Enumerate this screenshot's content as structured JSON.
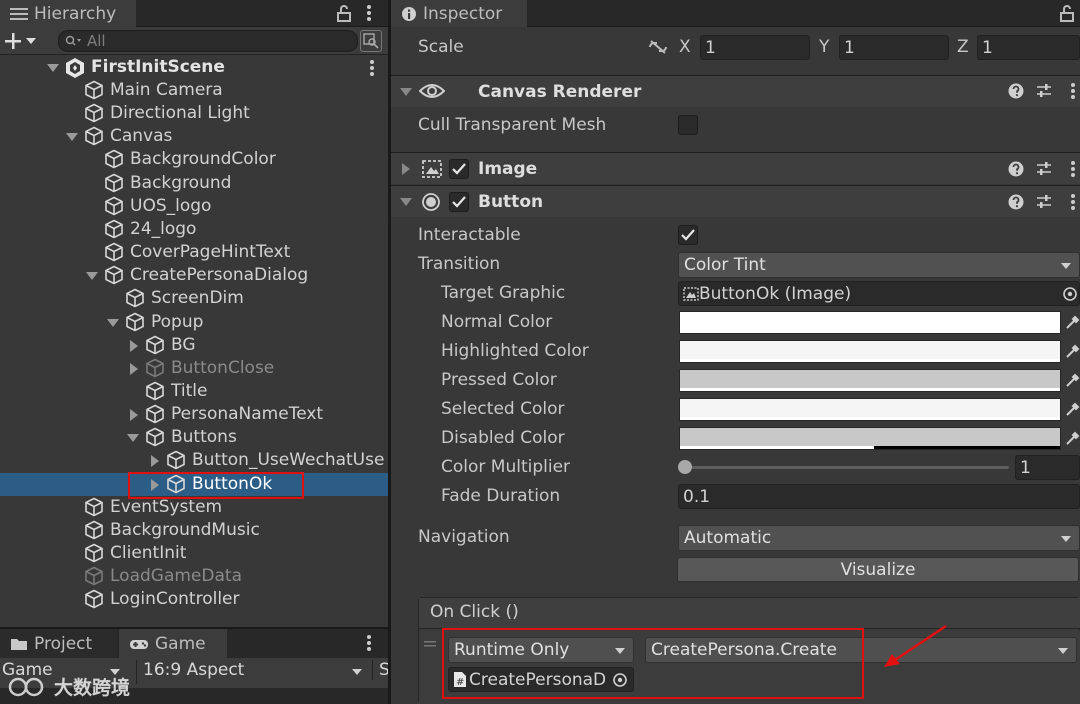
{
  "hierarchy": {
    "tab_label": "Hierarchy",
    "search_placeholder": "All",
    "scene_name": "FirstInitScene",
    "items": [
      {
        "label": "Main Camera"
      },
      {
        "label": "Directional Light"
      },
      {
        "label": "Canvas"
      },
      {
        "label": "BackgroundColor"
      },
      {
        "label": "Background"
      },
      {
        "label": "UOS_logo"
      },
      {
        "label": "24_logo"
      },
      {
        "label": "CoverPageHintText"
      },
      {
        "label": "CreatePersonaDialog"
      },
      {
        "label": "ScreenDim"
      },
      {
        "label": "Popup"
      },
      {
        "label": "BG"
      },
      {
        "label": "ButtonClose"
      },
      {
        "label": "Title"
      },
      {
        "label": "PersonaNameText"
      },
      {
        "label": "Buttons"
      },
      {
        "label": "Button_UseWechatUse"
      },
      {
        "label": "ButtonOk"
      },
      {
        "label": "EventSystem"
      },
      {
        "label": "BackgroundMusic"
      },
      {
        "label": "ClientInit"
      },
      {
        "label": "LoadGameData"
      },
      {
        "label": "LoginController"
      }
    ]
  },
  "bottom_panel": {
    "tabs": [
      {
        "label": "Project"
      },
      {
        "label": "Game"
      }
    ],
    "game_dropdown": "Game",
    "aspect_dropdown": "16:9 Aspect",
    "scale_label": "S",
    "watermark": "大数跨境"
  },
  "inspector": {
    "tab_label": "Inspector",
    "scale": {
      "label": "Scale",
      "x_label": "X",
      "x": "1",
      "y_label": "Y",
      "y": "1",
      "z_label": "Z",
      "z": "1"
    },
    "canvas_renderer": {
      "title": "Canvas Renderer",
      "cull_label": "Cull Transparent Mesh"
    },
    "image": {
      "title": "Image"
    },
    "button": {
      "title": "Button",
      "interactable_label": "Interactable",
      "transition_label": "Transition",
      "transition_value": "Color Tint",
      "target_graphic_label": "Target Graphic",
      "target_graphic_value": "ButtonOk (Image)",
      "normal_color_label": "Normal Color",
      "highlighted_color_label": "Highlighted Color",
      "pressed_color_label": "Pressed Color",
      "selected_color_label": "Selected Color",
      "disabled_color_label": "Disabled Color",
      "color_multiplier_label": "Color Multiplier",
      "color_multiplier_value": "1",
      "color_multiplier_fraction": 0,
      "fade_duration_label": "Fade Duration",
      "fade_duration_value": "0.1",
      "navigation_label": "Navigation",
      "navigation_value": "Automatic",
      "visualize_label": "Visualize"
    },
    "onclick": {
      "title": "On Click ()",
      "runtime_value": "Runtime Only",
      "function_value": "CreatePersona.Create",
      "object_value": "CreatePersonaD"
    }
  },
  "colors": {
    "normal": "#ffffff",
    "highlighted": "#f5f5f5",
    "pressed": "#c8c8c8",
    "selected": "#f5f5f5",
    "disabled": "#c8c8c8",
    "selection": "#2c5d87",
    "highlight_box": "#e01010"
  }
}
